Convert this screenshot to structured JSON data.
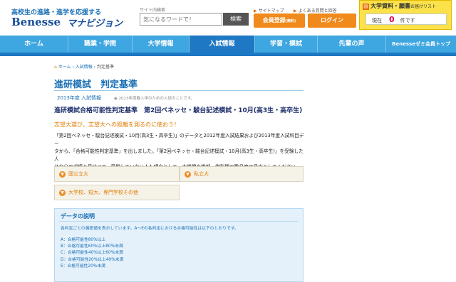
{
  "header": {
    "tagline": "高校生の進路・進学を応援する",
    "logo": "Benesse",
    "logo_sub": "マナビジョン",
    "search_caption": "サイト内検索",
    "search_placeholder": "気になるワードで！",
    "search_button": "検索",
    "link_sitemap": "サイトマップ",
    "link_faq": "よくある質問と回答",
    "register_button": "会員登録",
    "register_small": "(無料)",
    "login_button": "ログイン",
    "doc_title": "大学資料・願書",
    "doc_subtitle": "お届けリスト",
    "doc_current_label": "現在",
    "doc_count": "0",
    "doc_unit": "件です"
  },
  "nav": {
    "items": [
      {
        "label": "ホーム"
      },
      {
        "label": "職業・学問"
      },
      {
        "label": "大学情報"
      },
      {
        "label": "入試情報"
      },
      {
        "label": "学習・模試"
      },
      {
        "label": "先輩の声"
      },
      {
        "label": "Benesseゼミ会員トップ"
      }
    ],
    "active_index": 3
  },
  "breadcrumb": {
    "home": "ホーム",
    "parent": "入試情報",
    "current": "判定基準"
  },
  "page": {
    "title": "進研模試　判定基準",
    "year_label": "2013年度 入試情報",
    "year_note": "2013年度春入学のための入試のことです。",
    "sub_title": "進研模試合格可能性判定基準　第2回ベネッセ・駿台記述模試・10月(高3生・高卒生)",
    "tagline": "志望大選び、志望大への距離を測るのに使おう！",
    "body_lines": [
      "「第2回ベネッセ・駿台記述模試・10月(高3生・高卒生)」のデータと2012年度入試結果および2013年度入試科目デー",
      "タから、「合格可能性判定基準」を出しました。「第2回ベネッセ・駿台記述模試・10月(高3生・高卒生)」を受験した人",
      "は自分の成績と見比べて、受験していない人も傾向として、大学間や学部・学科間の難易度の目安としてください。"
    ]
  },
  "categories": [
    {
      "label": "国公立大"
    },
    {
      "label": "私立大"
    },
    {
      "label": "大学校、短大、専門学校その他"
    }
  ],
  "data_description": {
    "title": "データの説明",
    "text": "各判定ごとの偏差値を表示しています。A～Eの各判定における合格可能性は以下のとおりです。",
    "items": [
      "A：合格可能性80%以上",
      "B：合格可能性60%以上80%未満",
      "C：合格可能性40%以上60%未満",
      "D：合格可能性20%以上40%未満",
      "E：合格可能性20%未満"
    ]
  }
}
